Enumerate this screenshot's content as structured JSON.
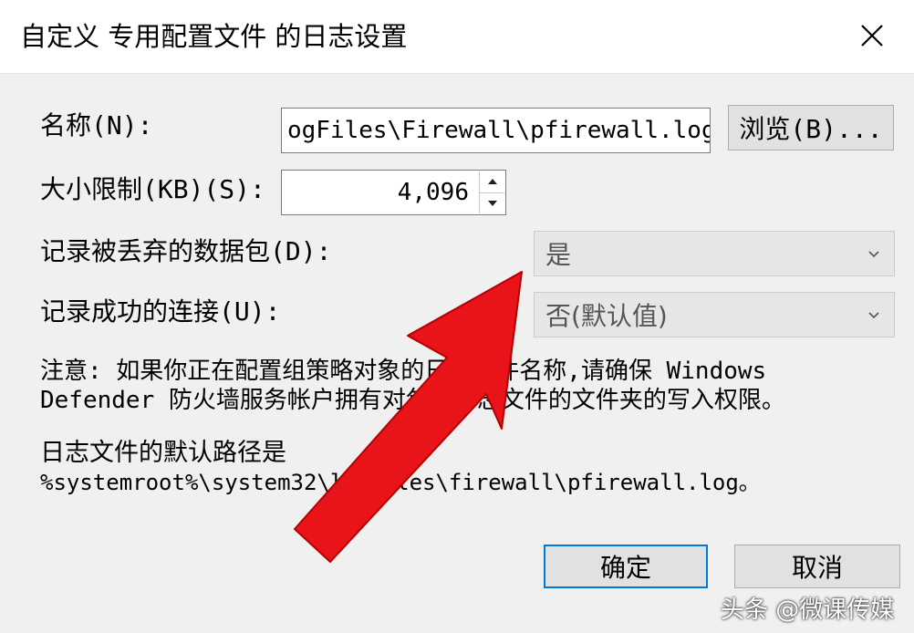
{
  "window": {
    "title": "自定义 专用配置文件 的日志设置"
  },
  "name_row": {
    "label": "名称(N):",
    "value": "ogFiles\\Firewall\\pfirewall.log",
    "browse_label": "浏览(B)..."
  },
  "size_row": {
    "label": "大小限制(KB)(S):",
    "value": "4,096"
  },
  "dropped_row": {
    "label": "记录被丢弃的数据包(D):",
    "selected": "是"
  },
  "success_row": {
    "label": "记录成功的连接(U):",
    "selected": "否(默认值)"
  },
  "note": {
    "line1": "注意: 如果你正在配置组策略对象的日志文件名称,请确保 Windows",
    "line2": "Defender 防火墙服务帐户拥有对包含日志文件的文件夹的写入权限。"
  },
  "default_path": {
    "label": "日志文件的默认路径是",
    "path": "%systemroot%\\system32\\logfiles\\firewall\\pfirewall.log。"
  },
  "buttons": {
    "ok": "确定",
    "cancel": "取消"
  },
  "watermark": "头条 @微课传媒",
  "colors": {
    "accent": "#0078d7",
    "arrow": "#e8141a"
  },
  "icons": {
    "close": "close-icon",
    "dropdown": "chevron-down-icon",
    "spin_up": "caret-up-icon",
    "spin_down": "caret-down-icon"
  }
}
